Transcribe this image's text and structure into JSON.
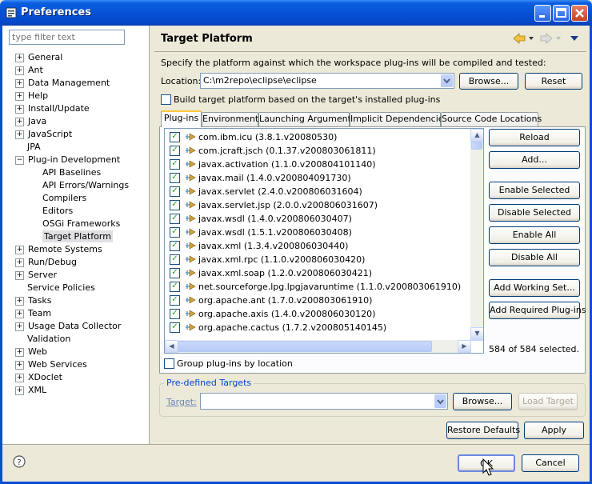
{
  "window": {
    "title": "Preferences"
  },
  "filter": {
    "placeholder": "type filter text"
  },
  "tree": [
    {
      "label": "General",
      "exp": true,
      "indent": 0
    },
    {
      "label": "Ant",
      "exp": true,
      "indent": 0
    },
    {
      "label": "Data Management",
      "exp": true,
      "indent": 0
    },
    {
      "label": "Help",
      "exp": true,
      "indent": 0
    },
    {
      "label": "Install/Update",
      "exp": true,
      "indent": 0
    },
    {
      "label": "Java",
      "exp": true,
      "indent": 0
    },
    {
      "label": "JavaScript",
      "exp": true,
      "indent": 0
    },
    {
      "label": "JPA",
      "exp": false,
      "indent": 0
    },
    {
      "label": "Plug-in Development",
      "exp": true,
      "open": true,
      "indent": 0
    },
    {
      "label": "API Baselines",
      "exp": false,
      "indent": 1
    },
    {
      "label": "API Errors/Warnings",
      "exp": false,
      "indent": 1
    },
    {
      "label": "Compilers",
      "exp": false,
      "indent": 1
    },
    {
      "label": "Editors",
      "exp": false,
      "indent": 1
    },
    {
      "label": "OSGi Frameworks",
      "exp": false,
      "indent": 1
    },
    {
      "label": "Target Platform",
      "exp": false,
      "indent": 1,
      "selected": true
    },
    {
      "label": "Remote Systems",
      "exp": true,
      "indent": 0
    },
    {
      "label": "Run/Debug",
      "exp": true,
      "indent": 0
    },
    {
      "label": "Server",
      "exp": true,
      "indent": 0
    },
    {
      "label": "Service Policies",
      "exp": false,
      "indent": 0
    },
    {
      "label": "Tasks",
      "exp": true,
      "indent": 0
    },
    {
      "label": "Team",
      "exp": true,
      "indent": 0
    },
    {
      "label": "Usage Data Collector",
      "exp": true,
      "indent": 0
    },
    {
      "label": "Validation",
      "exp": false,
      "indent": 0
    },
    {
      "label": "Web",
      "exp": true,
      "indent": 0
    },
    {
      "label": "Web Services",
      "exp": true,
      "indent": 0
    },
    {
      "label": "XDoclet",
      "exp": true,
      "indent": 0
    },
    {
      "label": "XML",
      "exp": true,
      "indent": 0
    }
  ],
  "page": {
    "title": "Target Platform",
    "description": "Specify the platform against which the workspace plug-ins will be compiled and tested:",
    "location_label": "Location:",
    "location_value": "C:\\m2repo\\eclipse\\eclipse",
    "browse": "Browse...",
    "reset": "Reset",
    "build_checkbox": "Build target platform based on the target's installed plug-ins"
  },
  "tabs": [
    "Plug-ins",
    "Environment",
    "Launching Arguments",
    "Implicit Dependencies",
    "Source Code Locations"
  ],
  "plugins": [
    "com.ibm.icu (3.8.1.v20080530)",
    "com.jcraft.jsch (0.1.37.v200803061811)",
    "javax.activation (1.1.0.v200804101140)",
    "javax.mail (1.4.0.v200804091730)",
    "javax.servlet (2.4.0.v200806031604)",
    "javax.servlet.jsp (2.0.0.v200806031607)",
    "javax.wsdl (1.4.0.v200806030407)",
    "javax.wsdl (1.5.1.v200806030408)",
    "javax.xml (1.3.4.v200806030440)",
    "javax.xml.rpc (1.1.0.v200806030420)",
    "javax.xml.soap (1.2.0.v200806030421)",
    "net.sourceforge.lpg.lpgjavaruntime (1.1.0.v200803061910)",
    "org.apache.ant (1.7.0.v200803061910)",
    "org.apache.axis (1.4.0.v200806030120)",
    "org.apache.cactus (1.7.2.v200805140145)"
  ],
  "side_buttons": [
    "Reload",
    "Add...",
    "Enable Selected",
    "Disable Selected",
    "Enable All",
    "Disable All",
    "Add Working Set...",
    "Add Required Plug-ins"
  ],
  "selected_count": "584 of 584 selected.",
  "group_checkbox": "Group plug-ins by location",
  "predefined": {
    "legend": "Pre-defined Targets",
    "target_label": "Target:",
    "browse": "Browse...",
    "load": "Load Target"
  },
  "restore_defaults": "Restore Defaults",
  "apply": "Apply",
  "ok": "OK",
  "cancel": "Cancel"
}
